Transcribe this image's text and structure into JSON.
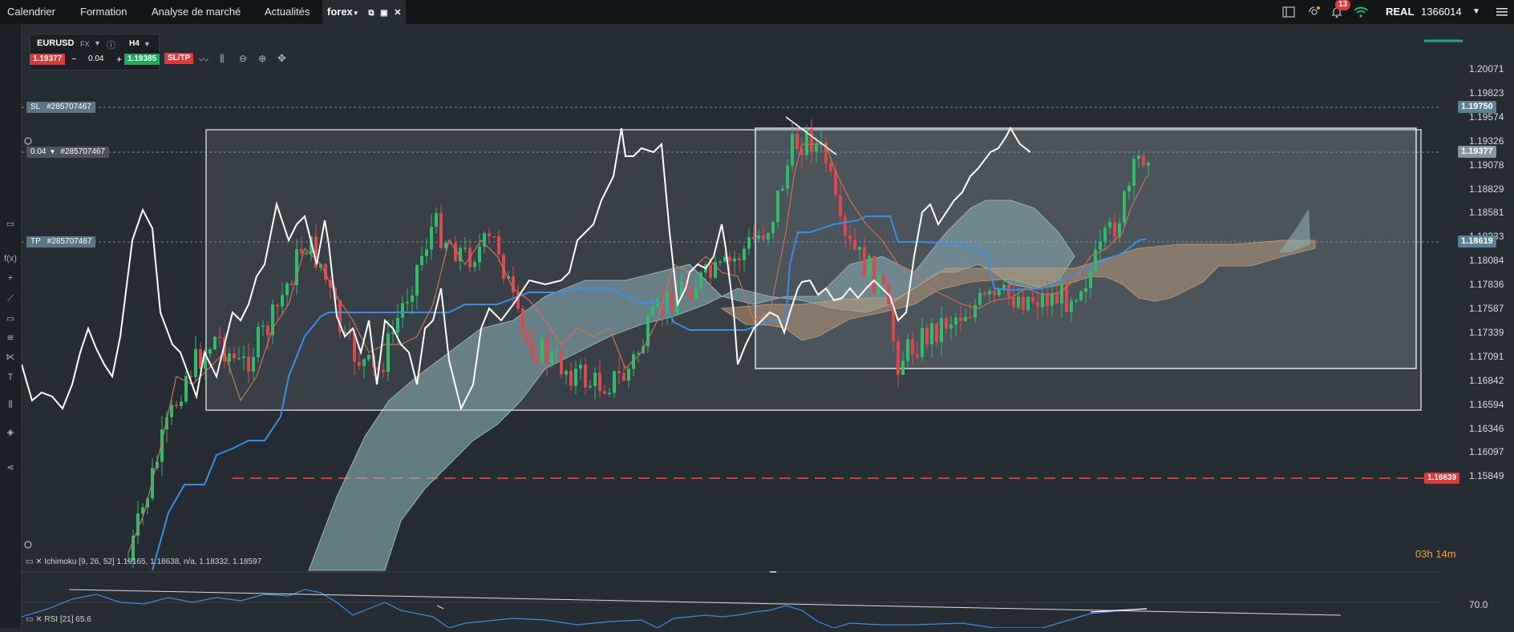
{
  "nav": {
    "tabs": [
      "Calendrier",
      "Formation",
      "Analyse de marché",
      "Actualités"
    ],
    "active_tab": "forex"
  },
  "notifications": {
    "count": "13"
  },
  "account": {
    "mode": "REAL",
    "number": "1366014"
  },
  "instrument": {
    "symbol": "EURUSD",
    "type": "FX",
    "timeframe": "H4"
  },
  "trade": {
    "sell_price": "1.19377",
    "volume": "0.04",
    "buy_price": "1.19385",
    "sltp_label": "SL/TP",
    "volume_tag": "0.04"
  },
  "orders": {
    "sl_label": "SL",
    "sl_id": "#285707467",
    "pos_id": "#285707467",
    "tp_label": "TP",
    "tp_id": "#285707467"
  },
  "price_axis": [
    "1.20071",
    "1.19823",
    "1.19574",
    "1.19326",
    "1.19078",
    "1.18829",
    "1.18581",
    "1.18333",
    "1.18084",
    "1.17836",
    "1.17587",
    "1.17339",
    "1.17091",
    "1.16842",
    "1.16594",
    "1.16346",
    "1.16097",
    "1.15849"
  ],
  "price_tags": {
    "sl": "1.19750",
    "current": "1.19377",
    "tp": "1.18619",
    "alert": "1.16639"
  },
  "indicators": {
    "ichimoku": "Ichimoku [9, 26, 52] 1.19165, 1.18638, n/a, 1.18332, 1.18597",
    "rsi": "RSI [21] 65.6",
    "rsi_level": "70.0"
  },
  "timer": "03h 14m",
  "colors": {
    "bull": "#2ebd6b",
    "bear": "#e0474c",
    "kijun": "#3a8ee6",
    "cloud_bull": "#8fbfbf",
    "cloud_bear": "#c9935a",
    "buy": "#1fa85f",
    "sell": "#d93a3a",
    "alert": "#d93a3a"
  }
}
